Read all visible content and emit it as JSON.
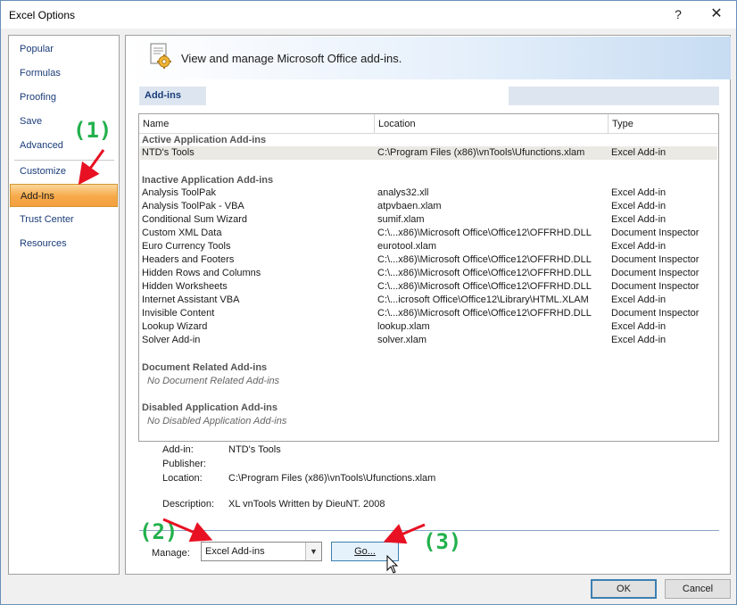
{
  "window": {
    "title": "Excel Options",
    "help": "?",
    "close": "✕"
  },
  "nav": {
    "items": [
      {
        "label": "Popular"
      },
      {
        "label": "Formulas"
      },
      {
        "label": "Proofing"
      },
      {
        "label": "Save"
      },
      {
        "label": "Advanced"
      },
      {
        "label": "Customize"
      },
      {
        "label": "Add-Ins",
        "active": true
      },
      {
        "label": "Trust Center"
      },
      {
        "label": "Resources"
      }
    ]
  },
  "banner": {
    "text": "View and manage Microsoft Office add-ins.",
    "icon": "addins-gear-icon"
  },
  "section": {
    "label": "Add-ins"
  },
  "list": {
    "columns": [
      "Name",
      "Location",
      "Type"
    ],
    "groups": {
      "active": "Active Application Add-ins",
      "inactive": "Inactive Application Add-ins",
      "document": "Document Related Add-ins",
      "document_empty": "No Document Related Add-ins",
      "disabled": "Disabled Application Add-ins",
      "disabled_empty": "No Disabled Application Add-ins"
    },
    "active_rows": [
      {
        "name": "NTD's Tools",
        "location": "C:\\Program Files (x86)\\vnTools\\Ufunctions.xlam",
        "type": "Excel Add-in"
      }
    ],
    "inactive_rows": [
      {
        "name": "Analysis ToolPak",
        "location": "analys32.xll",
        "type": "Excel Add-in"
      },
      {
        "name": "Analysis ToolPak - VBA",
        "location": "atpvbaen.xlam",
        "type": "Excel Add-in"
      },
      {
        "name": "Conditional Sum Wizard",
        "location": "sumif.xlam",
        "type": "Excel Add-in"
      },
      {
        "name": "Custom XML Data",
        "location": "C:\\...x86)\\Microsoft Office\\Office12\\OFFRHD.DLL",
        "type": "Document Inspector"
      },
      {
        "name": "Euro Currency Tools",
        "location": "eurotool.xlam",
        "type": "Excel Add-in"
      },
      {
        "name": "Headers and Footers",
        "location": "C:\\...x86)\\Microsoft Office\\Office12\\OFFRHD.DLL",
        "type": "Document Inspector"
      },
      {
        "name": "Hidden Rows and Columns",
        "location": "C:\\...x86)\\Microsoft Office\\Office12\\OFFRHD.DLL",
        "type": "Document Inspector"
      },
      {
        "name": "Hidden Worksheets",
        "location": "C:\\...x86)\\Microsoft Office\\Office12\\OFFRHD.DLL",
        "type": "Document Inspector"
      },
      {
        "name": "Internet Assistant VBA",
        "location": "C:\\...icrosoft Office\\Office12\\Library\\HTML.XLAM",
        "type": "Excel Add-in"
      },
      {
        "name": "Invisible Content",
        "location": "C:\\...x86)\\Microsoft Office\\Office12\\OFFRHD.DLL",
        "type": "Document Inspector"
      },
      {
        "name": "Lookup Wizard",
        "location": "lookup.xlam",
        "type": "Excel Add-in"
      },
      {
        "name": "Solver Add-in",
        "location": "solver.xlam",
        "type": "Excel Add-in"
      }
    ]
  },
  "details": {
    "addin_label": "Add-in:",
    "addin_value": "NTD's Tools",
    "publisher_label": "Publisher:",
    "publisher_value": "",
    "location_label": "Location:",
    "location_value": "C:\\Program Files (x86)\\vnTools\\Ufunctions.xlam",
    "description_label": "Description:",
    "description_value": "XL vnTools Written by DieuNT. 2008"
  },
  "manage": {
    "label": "Manage:",
    "selected": "Excel Add-ins",
    "go_label": "Go..."
  },
  "footer": {
    "ok": "OK",
    "cancel": "Cancel"
  },
  "annotations": {
    "one": "(1)",
    "two": "(2)",
    "three": "(3)",
    "color": "#22b14c",
    "arrow_color": "#e81123"
  }
}
